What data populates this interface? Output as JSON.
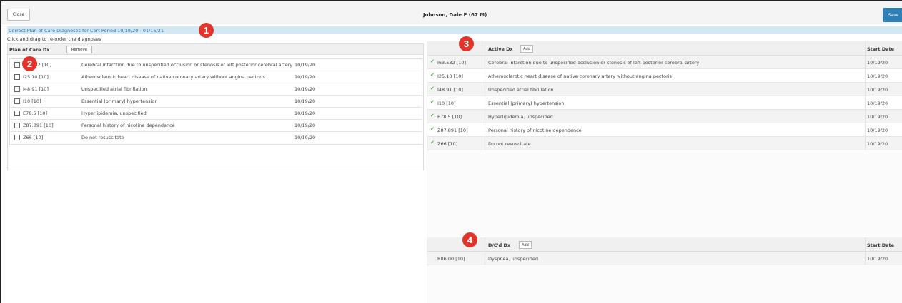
{
  "header": {
    "close_label": "Close",
    "patient": "Johnson, Dale F (67 M)",
    "save_label": "Save"
  },
  "subheader": {
    "link": "Correct Plan of Care Diagnoses for Cert Period 10/19/20 - 01/16/21",
    "hint": "Click and drag to re-order the diagnoses"
  },
  "badges": [
    "1",
    "2",
    "3",
    "4"
  ],
  "plan_of_care": {
    "title": "Plan of Care Dx",
    "remove_label": "Remove",
    "rows": [
      {
        "code": "I63.532 [10]",
        "desc": "Cerebral infarction due to unspecified occlusion or stenosis of left posterior cerebral artery",
        "date": "10/19/20"
      },
      {
        "code": "I25.10 [10]",
        "desc": "Atherosclerotic heart disease of native coronary artery without angina pectoris",
        "date": "10/19/20"
      },
      {
        "code": "I48.91 [10]",
        "desc": "Unspecified atrial fibrillation",
        "date": "10/19/20"
      },
      {
        "code": "I10 [10]",
        "desc": "Essential (primary) hypertension",
        "date": "10/19/20"
      },
      {
        "code": "E78.5 [10]",
        "desc": "Hyperlipidemia, unspecified",
        "date": "10/19/20"
      },
      {
        "code": "Z87.891 [10]",
        "desc": "Personal history of nicotine dependence",
        "date": "10/19/20"
      },
      {
        "code": "Z66 [10]",
        "desc": "Do not resuscitate",
        "date": "10/19/20"
      }
    ]
  },
  "active_dx": {
    "title": "Active Dx",
    "add_label": "Add",
    "start_date_header": "Start Date",
    "rows": [
      {
        "code": "I63.532 [10]",
        "desc": "Cerebral infarction due to unspecified occlusion or stenosis of left posterior cerebral artery",
        "date": "10/19/20"
      },
      {
        "code": "I25.10 [10]",
        "desc": "Atherosclerotic heart disease of native coronary artery without angina pectoris",
        "date": "10/19/20"
      },
      {
        "code": "I48.91 [10]",
        "desc": "Unspecified atrial fibrillation",
        "date": "10/19/20"
      },
      {
        "code": "I10 [10]",
        "desc": "Essential (primary) hypertension",
        "date": "10/19/20"
      },
      {
        "code": "E78.5 [10]",
        "desc": "Hyperlipidemia, unspecified",
        "date": "10/19/20"
      },
      {
        "code": "Z87.891 [10]",
        "desc": "Personal history of nicotine dependence",
        "date": "10/19/20"
      },
      {
        "code": "Z66 [10]",
        "desc": "Do not resuscitate",
        "date": "10/19/20"
      }
    ]
  },
  "dcd_dx": {
    "title": "D/C'd Dx",
    "add_label": "Add",
    "start_date_header": "Start Date",
    "rows": [
      {
        "code": "R06.00 [10]",
        "desc": "Dyspnea, unspecified",
        "date": "10/19/20"
      }
    ]
  },
  "colors": {
    "save_button": "#2d7fb6",
    "link": "#1f6fa8",
    "subbar": "#d4e8f3",
    "badge": "#e2342b",
    "check": "#4caf50"
  }
}
